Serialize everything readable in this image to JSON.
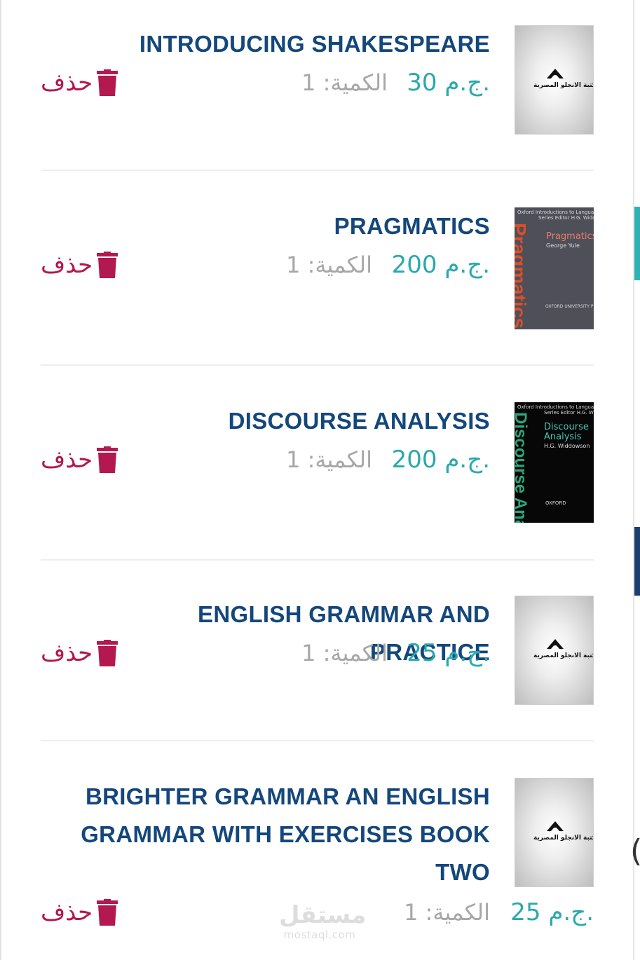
{
  "cart": {
    "delete_label": "حذف",
    "items": [
      {
        "title": "INTRODUCING SHAKESPEARE",
        "price": "30 ج.م.",
        "quantity": "الكمية: 1"
      },
      {
        "title": "PRAGMATICS",
        "price": "200 ج.م.",
        "quantity": "الكمية: 1"
      },
      {
        "title": "DISCOURSE ANALYSIS",
        "price": "200 ج.م.",
        "quantity": "الكمية: 1"
      },
      {
        "title": "ENGLISH GRAMMAR AND PRACTICE",
        "price": "25 ج.م.",
        "quantity": "الكمية: 1"
      },
      {
        "title": "BRIGHTER GRAMMAR AN ENGLISH GRAMMAR WITH EXERCISES BOOK TWO",
        "price": "25 ج.م.",
        "quantity": "الكمية: 1"
      }
    ]
  },
  "covers": {
    "placeholder_logo_text": "مكتبة الانجلو المصرية",
    "pragmatics": {
      "series": "Oxford Introductions to Language Study",
      "editor": "Series Editor H.G. Widdowson",
      "title": "Pragmatics",
      "author": "George Yule",
      "spine": "Pragmatics",
      "publisher": "OXFORD UNIVERSITY PRESS"
    },
    "discourse": {
      "series": "Oxford Introductions to Language Study",
      "editor": "Series Editor H.G. Widdowson",
      "title_line1": "Discourse",
      "title_line2": "Analysis",
      "author": "H.G. Widdowson",
      "spine": "Discourse Analysis",
      "publisher": "OXFORD"
    }
  },
  "watermark": {
    "arabic": "مستقل",
    "latin": "mostaql.com"
  },
  "colors": {
    "title": "#14477c",
    "price": "#2aa9ae",
    "quantity": "#a7a7a7",
    "delete": "#b3184f"
  },
  "icons": {
    "delete": "trash-icon",
    "logo": "arch-logo-icon"
  }
}
